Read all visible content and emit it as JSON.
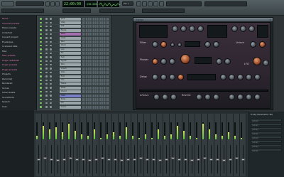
{
  "topbar": {
    "time_display": "22:00:00",
    "tempo": "130.000",
    "pattern": "Pat 1",
    "menu_icons": [
      "file-icon",
      "edit-icon",
      "channels-icon",
      "view-icon",
      "options-icon",
      "tools-icon",
      "help-icon"
    ]
  },
  "browser": {
    "items": [
      {
        "label": "Packs",
        "color": "#e07ab8"
      },
      {
        "label": "Channel presets",
        "color": "#e07ab8"
      },
      {
        "label": "Mixer presets",
        "color": "#c6cdd0"
      },
      {
        "label": "Collected",
        "color": "#c6cdd0"
      },
      {
        "label": "Current project",
        "color": "#c6cdd0"
      },
      {
        "label": "Envelopes",
        "color": "#c6cdd0"
      },
      {
        "label": "IL shared data",
        "color": "#c6cdd0"
      },
      {
        "label": "Misc",
        "color": "#c6cdd0"
      },
      {
        "label": "Misc presets",
        "color": "#e07ab8"
      },
      {
        "label": "Plugin database",
        "color": "#e07ab8"
      },
      {
        "label": "Plugin presets",
        "color": "#e07ab8"
      },
      {
        "label": "Plugin presets",
        "color": "#e07ab8"
      },
      {
        "label": "Projects",
        "color": "#c6cdd0"
      },
      {
        "label": "Recorded",
        "color": "#c6cdd0"
      },
      {
        "label": "Rendered",
        "color": "#c6cdd0"
      },
      {
        "label": "Scores",
        "color": "#c6cdd0"
      },
      {
        "label": "Sliced beats",
        "color": "#c6cdd0"
      },
      {
        "label": "Soundfonts",
        "color": "#c6cdd0"
      },
      {
        "label": "Speech",
        "color": "#c6cdd0"
      },
      {
        "label": "User",
        "color": "#c6cdd0"
      }
    ]
  },
  "channels": [
    {
      "name": "Kick",
      "color": "#9aa5a9"
    },
    {
      "name": "Clap",
      "color": "#9aa5a9"
    },
    {
      "name": "Hat",
      "color": "#9aa5a9"
    },
    {
      "name": "Snare",
      "color": "#9aa5a9"
    },
    {
      "name": "Bass",
      "color": "#a66fb0"
    },
    {
      "name": "Lead",
      "color": "#9aa5a9"
    },
    {
      "name": "Pad",
      "color": "#9aa5a9"
    },
    {
      "name": "Pluck",
      "color": "#9aa5a9"
    },
    {
      "name": "Arp",
      "color": "#9aa5a9"
    },
    {
      "name": "FX",
      "color": "#9aa5a9"
    },
    {
      "name": "Sub",
      "color": "#9aa5a9"
    },
    {
      "name": "Synth",
      "color": "#9aa5a9"
    },
    {
      "name": "Perc",
      "color": "#9aa5a9"
    },
    {
      "name": "Crash",
      "color": "#9aa5a9"
    },
    {
      "name": "Ride",
      "color": "#9aa5a9"
    },
    {
      "name": "Tom",
      "color": "#9aa5a9"
    },
    {
      "name": "Vox",
      "color": "#9aa5a9"
    },
    {
      "name": "Noise",
      "color": "#9aa5a9"
    },
    {
      "name": "Riser",
      "color": "#9aa5a9"
    },
    {
      "name": "Chord",
      "color": "#9aa5a9"
    },
    {
      "name": "Stab",
      "color": "#7a7fc9"
    },
    {
      "name": "Drop",
      "color": "#9aa5a9"
    },
    {
      "name": "Fill",
      "color": "#9aa5a9"
    },
    {
      "name": "Outro",
      "color": "#9aa5a9"
    }
  ],
  "synth": {
    "title": "Sytrus",
    "sections": {
      "filter": "Filter",
      "unison": "Unison",
      "phaser": "Phaser",
      "delay": "Delay",
      "reverb": "Reverb",
      "chorus": "Chorus",
      "lfo": "LFO"
    }
  },
  "mixer": {
    "levels": [
      0.2,
      0.8,
      0.6,
      0.7,
      0.4,
      0.9,
      0.5,
      0.3,
      0.2,
      0.6,
      0.1,
      0.3,
      0.4,
      0.2,
      0.7,
      0.2,
      0.1,
      0.3,
      0.1,
      0.6,
      0.2,
      0.3,
      0.8,
      0.5,
      0.2,
      0.1,
      0.9,
      0.6,
      0.3,
      0.2,
      0.4,
      0.2,
      0.1
    ],
    "fader_positions": [
      0.5,
      0.45,
      0.5,
      0.55,
      0.5,
      0.45,
      0.5,
      0.5,
      0.55,
      0.5,
      0.45,
      0.5,
      0.5,
      0.55,
      0.5,
      0.5,
      0.45,
      0.5,
      0.5,
      0.55,
      0.5,
      0.45,
      0.5,
      0.5,
      0.55,
      0.5,
      0.45,
      0.5,
      0.5,
      0.55,
      0.5,
      0.45,
      0.5
    ]
  },
  "fx_panel": {
    "title": "Fruity Parametric EQ",
    "slots": [
      "(none)",
      "(none)",
      "(none)",
      "(none)",
      "(none)",
      "(none)",
      "(none)",
      "(none)"
    ]
  }
}
